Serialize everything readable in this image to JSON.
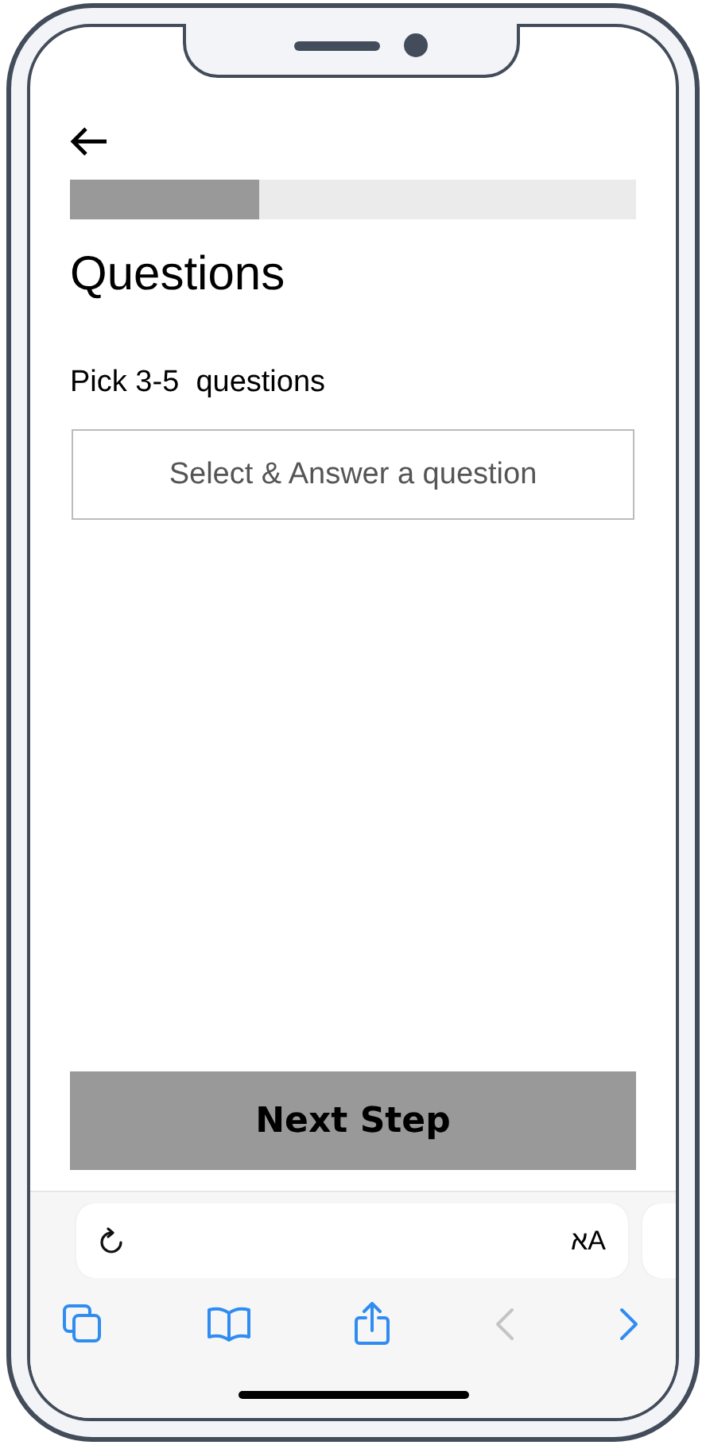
{
  "header": {
    "progress": {
      "level": 0.335
    }
  },
  "title": "Questions",
  "instruction": "Pick 3-5  questions",
  "question_field": {
    "placeholder": "Select & Answer a question"
  },
  "next_button": {
    "label": "Next Step",
    "disabled": true
  },
  "browser": {
    "address_bar": {
      "text_size_label": "אA"
    },
    "toolbar": [
      {
        "kind": "tabs",
        "disabled": false
      },
      {
        "kind": "bookmarks",
        "disabled": false
      },
      {
        "kind": "share",
        "disabled": false
      },
      {
        "kind": "back",
        "disabled": true
      },
      {
        "kind": "forward",
        "disabled": false
      }
    ]
  }
}
